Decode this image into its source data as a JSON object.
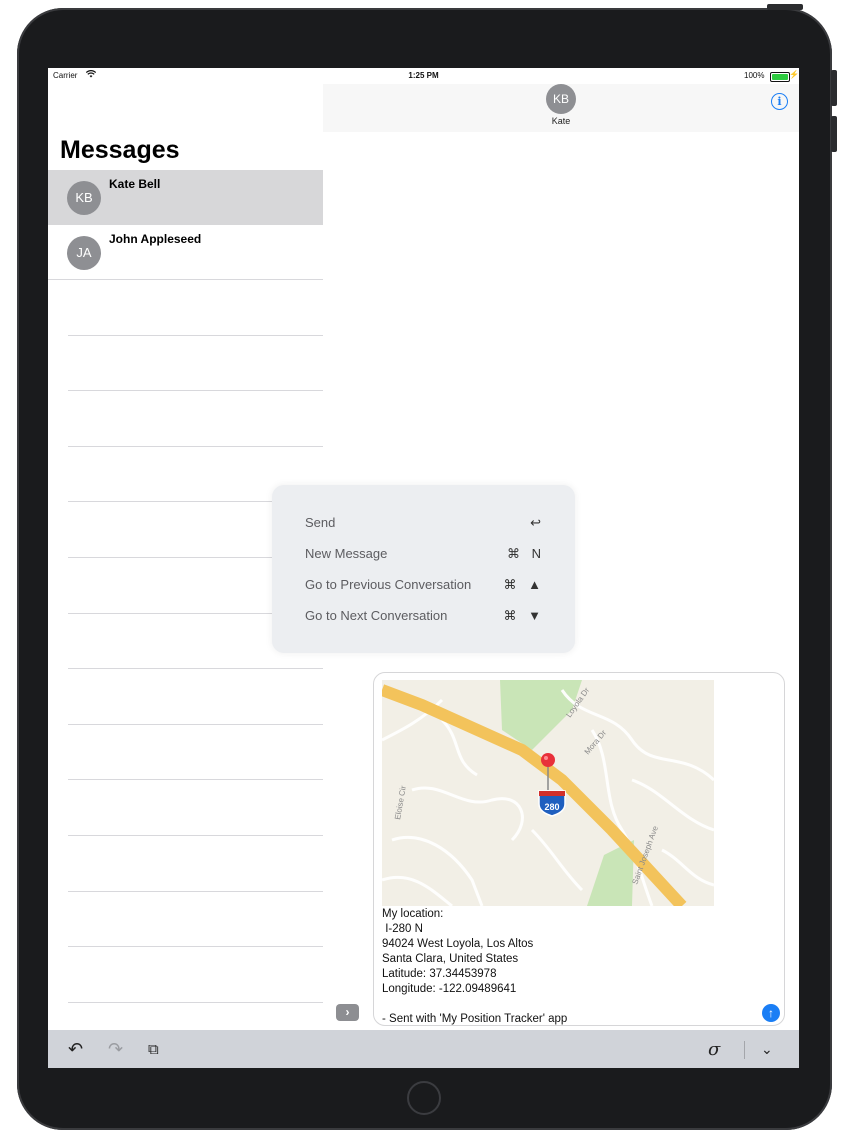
{
  "status_bar": {
    "carrier": "Carrier",
    "time": "1:25 PM",
    "battery": "100%"
  },
  "nav": {
    "contact_initials": "KB",
    "contact_name": "Kate"
  },
  "sidebar": {
    "title": "Messages",
    "conversations": [
      {
        "initials": "KB",
        "name": "Kate Bell",
        "selected": true
      },
      {
        "initials": "JA",
        "name": "John Appleseed",
        "selected": false
      }
    ]
  },
  "shortcuts": [
    {
      "label": "Send",
      "key": "↩"
    },
    {
      "label": "New Message",
      "key": "⌘ N"
    },
    {
      "label": "Go to Previous Conversation",
      "key": "⌘ ▲"
    },
    {
      "label": "Go to Next Conversation",
      "key": "⌘ ▼"
    }
  ],
  "map": {
    "highway_shield": "280",
    "street_labels": [
      "Loyola Dr",
      "Mora Dr",
      "Eloise Cir",
      "Saint Joseph Ave"
    ]
  },
  "message": {
    "lines": [
      "My location:",
      " I-280 N",
      "94024 West Loyola, Los Altos",
      "Santa Clara, United States",
      "Latitude: 37.34453978",
      "Longitude: -122.09489641",
      "",
      "- Sent with 'My Position Tracker' app"
    ]
  },
  "colors": {
    "accent": "#1a7ef5",
    "selected_row": "#d7d7d9",
    "avatar": "#8e8f93",
    "highway": "#f3c35b",
    "park": "#c9e5b7"
  }
}
